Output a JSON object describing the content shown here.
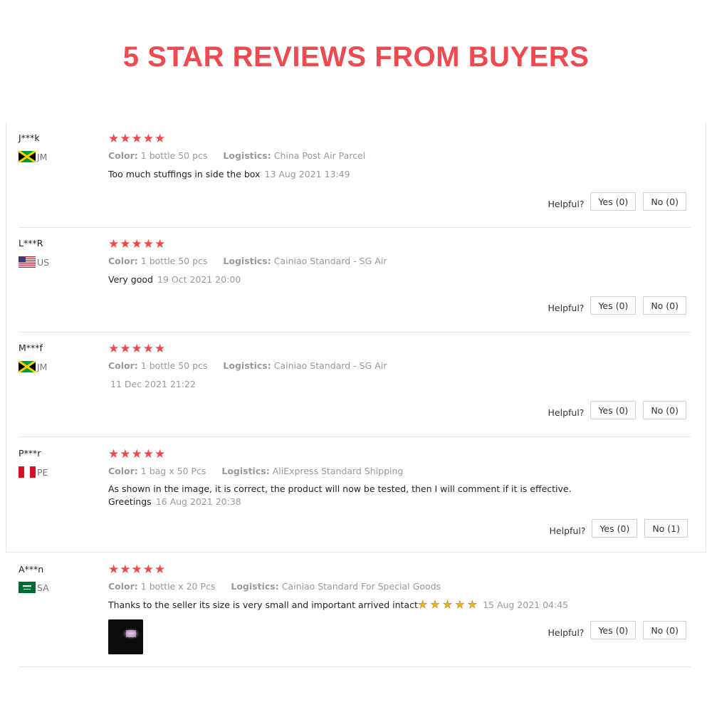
{
  "header": {
    "title": "5 STAR REVIEWS FROM BUYERS"
  },
  "labels": {
    "color": "Color:",
    "logistics": "Logistics:",
    "helpful": "Helpful?"
  },
  "colors": {
    "title": "#ee4a50",
    "star": "#f04848",
    "gold_star": "#f2b01e"
  },
  "reviews": [
    {
      "user": "J***k",
      "country": "JM",
      "flag_icon": "jamaica-flag-icon",
      "rating": 5,
      "color_value": "1 bottle 50 pcs",
      "logistics_value": "China Post Air Parcel",
      "text": "Too much stuffings in side the box",
      "date": "13 Aug 2021 13:49",
      "yes": "Yes (0)",
      "no": "No (0)"
    },
    {
      "user": "L***R",
      "country": "US",
      "flag_icon": "usa-flag-icon",
      "rating": 5,
      "color_value": "1 bottle 50 pcs",
      "logistics_value": "Cainiao Standard - SG Air",
      "text": "Very good",
      "date": "19 Oct 2021 20:00",
      "yes": "Yes (0)",
      "no": "No (0)"
    },
    {
      "user": "M***f",
      "country": "JM",
      "flag_icon": "jamaica-flag-icon",
      "rating": 5,
      "color_value": "1 bottle 50 pcs",
      "logistics_value": "Cainiao Standard - SG Air",
      "text": "",
      "date": "11 Dec 2021 21:22",
      "yes": "Yes (0)",
      "no": "No (0)"
    },
    {
      "user": "P***r",
      "country": "PE",
      "flag_icon": "peru-flag-icon",
      "rating": 5,
      "color_value": "1 bag x 50 Pcs",
      "logistics_value": "AliExpress Standard Shipping",
      "text": "As shown in the image, it is correct, the product will now be tested, then I will comment if it is effective. Greetings",
      "date": "16 Aug 2021 20:38",
      "yes": "Yes (0)",
      "no": "No (1)"
    },
    {
      "user": "A***n",
      "country": "SA",
      "flag_icon": "saudi-arabia-flag-icon",
      "rating": 5,
      "color_value": "1 bottle x 20 Pcs",
      "logistics_value": "Cainiao Standard For Special Goods",
      "text": "Thanks to the seller its size is very small and important arrived intact",
      "text_emoji_stars": 5,
      "date": "15 Aug 2021 04:45",
      "has_photo": true,
      "yes": "Yes (0)",
      "no": "No (0)"
    }
  ]
}
